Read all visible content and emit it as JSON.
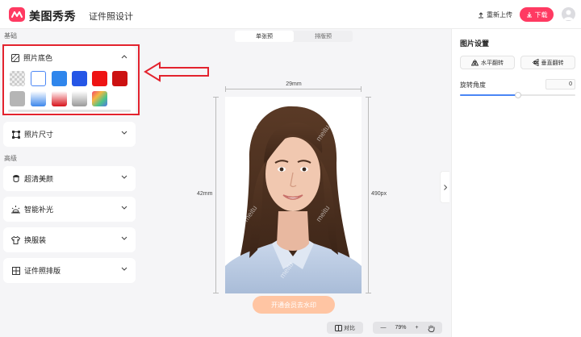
{
  "header": {
    "logo_text": "美图秀秀",
    "app_title": "证件照设计",
    "reupload_label": "重新上传",
    "download_label": "下载"
  },
  "left": {
    "section_basic": "基础",
    "background": {
      "title": "照片底色",
      "swatches": [
        {
          "name": "transparent",
          "color": "checker"
        },
        {
          "name": "white",
          "color": "#ffffff",
          "selected": true
        },
        {
          "name": "light-blue",
          "color": "#2f86ec"
        },
        {
          "name": "blue",
          "color": "#2556e6"
        },
        {
          "name": "red",
          "color": "#ee1414"
        },
        {
          "name": "dark-red",
          "color": "#cc1111"
        },
        {
          "name": "gray",
          "color": "#b5b5b5"
        },
        {
          "name": "blue-gradient",
          "color": "linear-gradient(#ffffff,#3d87ec)"
        },
        {
          "name": "red-gradient",
          "color": "linear-gradient(#ffffff,#d8131b)"
        },
        {
          "name": "gray-gradient",
          "color": "linear-gradient(#ffffff,#9a9a9a)"
        },
        {
          "name": "custom",
          "color": "linear-gradient(135deg,#f3476b,#f5b643,#4ac48a,#5274e8)"
        }
      ]
    },
    "photo_size": "照片尺寸",
    "section_advanced": "高级",
    "items": [
      {
        "label": "超清美颜",
        "icon": "face-icon"
      },
      {
        "label": "智能补光",
        "icon": "light-icon"
      },
      {
        "label": "换服装",
        "icon": "shirt-icon"
      },
      {
        "label": "证件照排版",
        "icon": "grid-icon"
      }
    ]
  },
  "center": {
    "tabs": [
      {
        "label": "单张预",
        "active": true
      },
      {
        "label": "排版预",
        "active": false
      }
    ],
    "width_label": "29mm",
    "height_label": "42mm",
    "pixel_label": "490px",
    "watermark_text": "meitu",
    "vip_button": "开通会员去水印",
    "compare_label": "对比",
    "zoom_minus": "—",
    "zoom_value": "79%",
    "zoom_plus": "+"
  },
  "right": {
    "title": "图片设置",
    "flip_horizontal": "水平翻转",
    "flip_vertical": "垂直翻转",
    "rotation_label": "旋转角度",
    "rotation_value": "0",
    "slider_fraction": 0.5
  },
  "colors": {
    "accent": "#ff3a62",
    "highlight": "#e3232e",
    "primary_blue": "#4a86f5"
  }
}
